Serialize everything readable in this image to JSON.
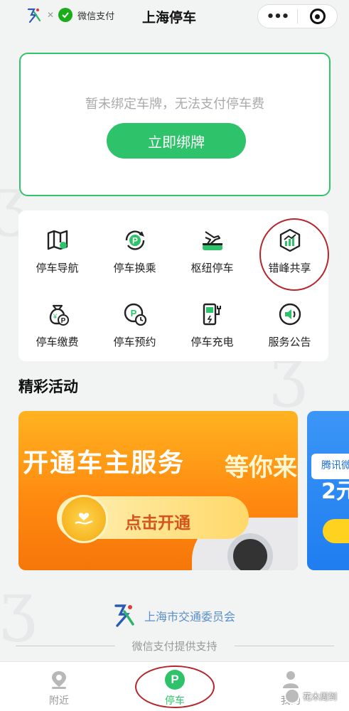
{
  "header": {
    "partner_text": "微信支付",
    "title": "上海停车",
    "capsule_more": "•••"
  },
  "bind_card": {
    "message": "暂未绑定车牌，无法支付停车费",
    "button": "立即绑牌"
  },
  "services": [
    {
      "label": "停车导航",
      "icon": "map-icon"
    },
    {
      "label": "停车换乘",
      "icon": "park-transfer-icon"
    },
    {
      "label": "枢纽停车",
      "icon": "hub-parking-icon"
    },
    {
      "label": "错峰共享",
      "icon": "chart-share-icon"
    },
    {
      "label": "停车缴费",
      "icon": "money-bag-icon"
    },
    {
      "label": "停车预约",
      "icon": "park-clock-icon"
    },
    {
      "label": "停车充电",
      "icon": "charger-icon"
    },
    {
      "label": "服务公告",
      "icon": "speaker-icon"
    }
  ],
  "activities": {
    "title": "精彩活动",
    "banner": {
      "headline": "开通车主服务",
      "headline_tail": "等你来",
      "button": "点击开通"
    },
    "banner2": {
      "line1": "腾讯微",
      "line2": "2元"
    }
  },
  "footer": {
    "org": "上海市交通委员会",
    "support": "微信支付提供支持"
  },
  "tabbar": {
    "tabs": [
      {
        "label": "附近",
        "icon": "location-pin-icon"
      },
      {
        "label": "停车",
        "icon": "parking-p-icon"
      },
      {
        "label": "我的",
        "icon": "person-icon"
      }
    ],
    "active": 1
  },
  "watermark": {
    "text": "花木周到"
  },
  "colors": {
    "brand_green": "#2ec36a",
    "annotation_red": "#b5272d",
    "banner_orange": "#ff8a10"
  }
}
